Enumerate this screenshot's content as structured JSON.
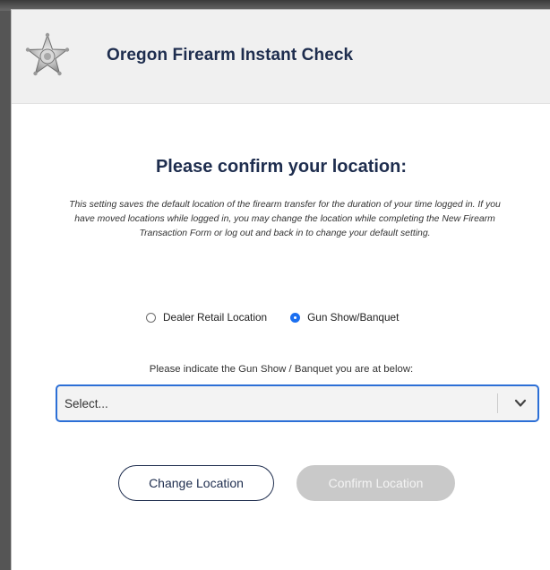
{
  "header": {
    "title": "Oregon Firearm Instant Check",
    "logo_icon": "star-badge-icon"
  },
  "location_form": {
    "heading": "Please confirm your location:",
    "description": "This setting saves the default location of the firearm transfer for the duration of your time logged in. If you have moved locations while logged in, you may change the location while completing the New Firearm Transaction Form or log out and back in to change your default setting.",
    "options": [
      {
        "label": "Dealer Retail Location",
        "checked": false
      },
      {
        "label": "Gun Show/Banquet",
        "checked": true
      }
    ],
    "instruction": "Please indicate the Gun Show / Banquet you are at below:",
    "select": {
      "value": "Select...",
      "icon": "chevron-down-icon"
    }
  },
  "buttons": {
    "change_label": "Change Location",
    "confirm_label": "Confirm Location",
    "confirm_disabled": true
  },
  "colors": {
    "brand_navy": "#1e2d4e",
    "accent_blue": "#2c6fd6",
    "radio_blue": "#1b6ff0",
    "disabled_gray": "#c9c9c9"
  }
}
